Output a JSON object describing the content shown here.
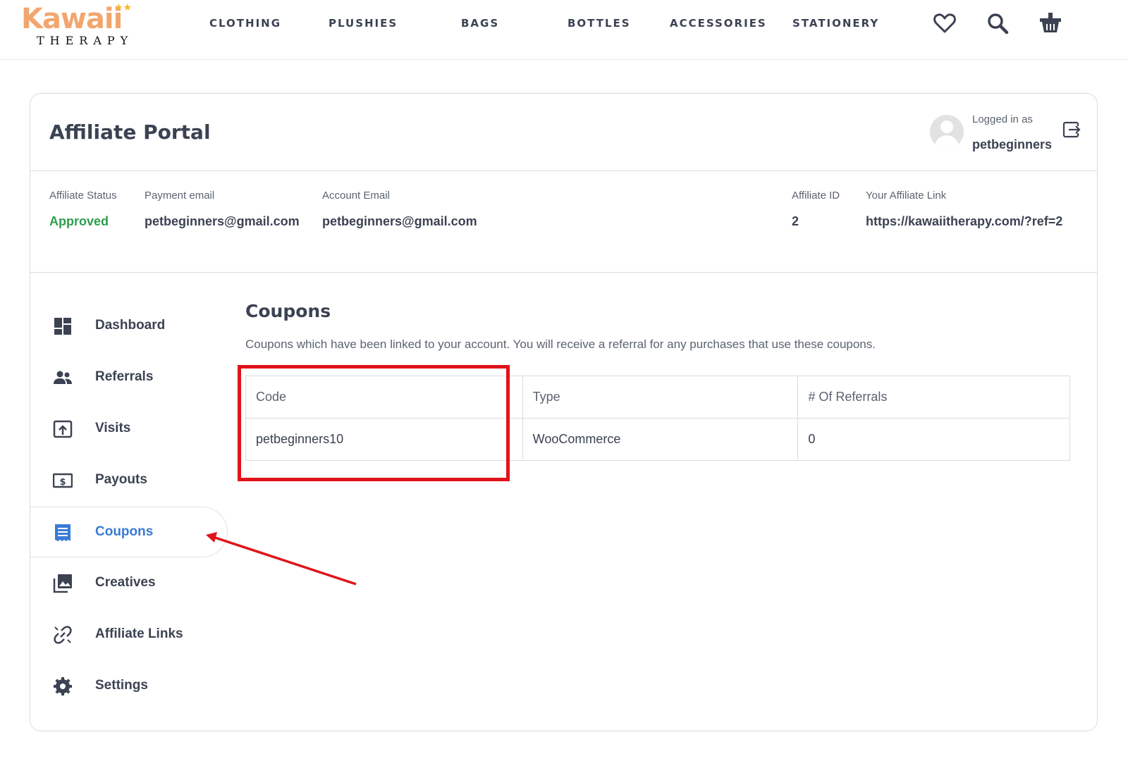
{
  "brand": {
    "logo_text": "Kawaii",
    "logo_sub": "THERAPY"
  },
  "nav": {
    "items": [
      "CLOTHING",
      "PLUSHIES",
      "BAGS",
      "BOTTLES",
      "ACCESSORIES",
      "STATIONERY"
    ],
    "icons": [
      "heart-icon",
      "search-icon",
      "basket-icon"
    ]
  },
  "portal": {
    "title": "Affiliate Portal",
    "logged_in_label": "Logged in as",
    "username": "petbeginners"
  },
  "info": {
    "status_label": "Affiliate Status",
    "status_value": "Approved",
    "payment_email_label": "Payment email",
    "payment_email_value": "petbeginners@gmail.com",
    "account_email_label": "Account Email",
    "account_email_value": "petbeginners@gmail.com",
    "affiliate_id_label": "Affiliate ID",
    "affiliate_id_value": "2",
    "affiliate_link_label": "Your Affiliate Link",
    "affiliate_link_value": "https://kawaiitherapy.com/?ref=2"
  },
  "sidebar": {
    "items": [
      {
        "label": "Dashboard",
        "icon": "dashboard-icon"
      },
      {
        "label": "Referrals",
        "icon": "people-icon"
      },
      {
        "label": "Visits",
        "icon": "visits-icon"
      },
      {
        "label": "Payouts",
        "icon": "dollar-icon"
      },
      {
        "label": "Coupons",
        "icon": "coupon-icon",
        "active": true
      },
      {
        "label": "Creatives",
        "icon": "images-icon"
      },
      {
        "label": "Affiliate Links",
        "icon": "link-icon"
      },
      {
        "label": "Settings",
        "icon": "gear-icon"
      }
    ]
  },
  "coupons": {
    "title": "Coupons",
    "description": "Coupons which have been linked to your account. You will receive a referral for any purchases that use these coupons.",
    "columns": [
      "Code",
      "Type",
      "# Of Referrals"
    ],
    "rows": [
      [
        "petbeginners10",
        "WooCommerce",
        "0"
      ]
    ]
  },
  "colors": {
    "accent": "#3a7bd5",
    "approved": "#2e9e4f",
    "highlight": "#e0141a",
    "text": "#3b4252"
  }
}
